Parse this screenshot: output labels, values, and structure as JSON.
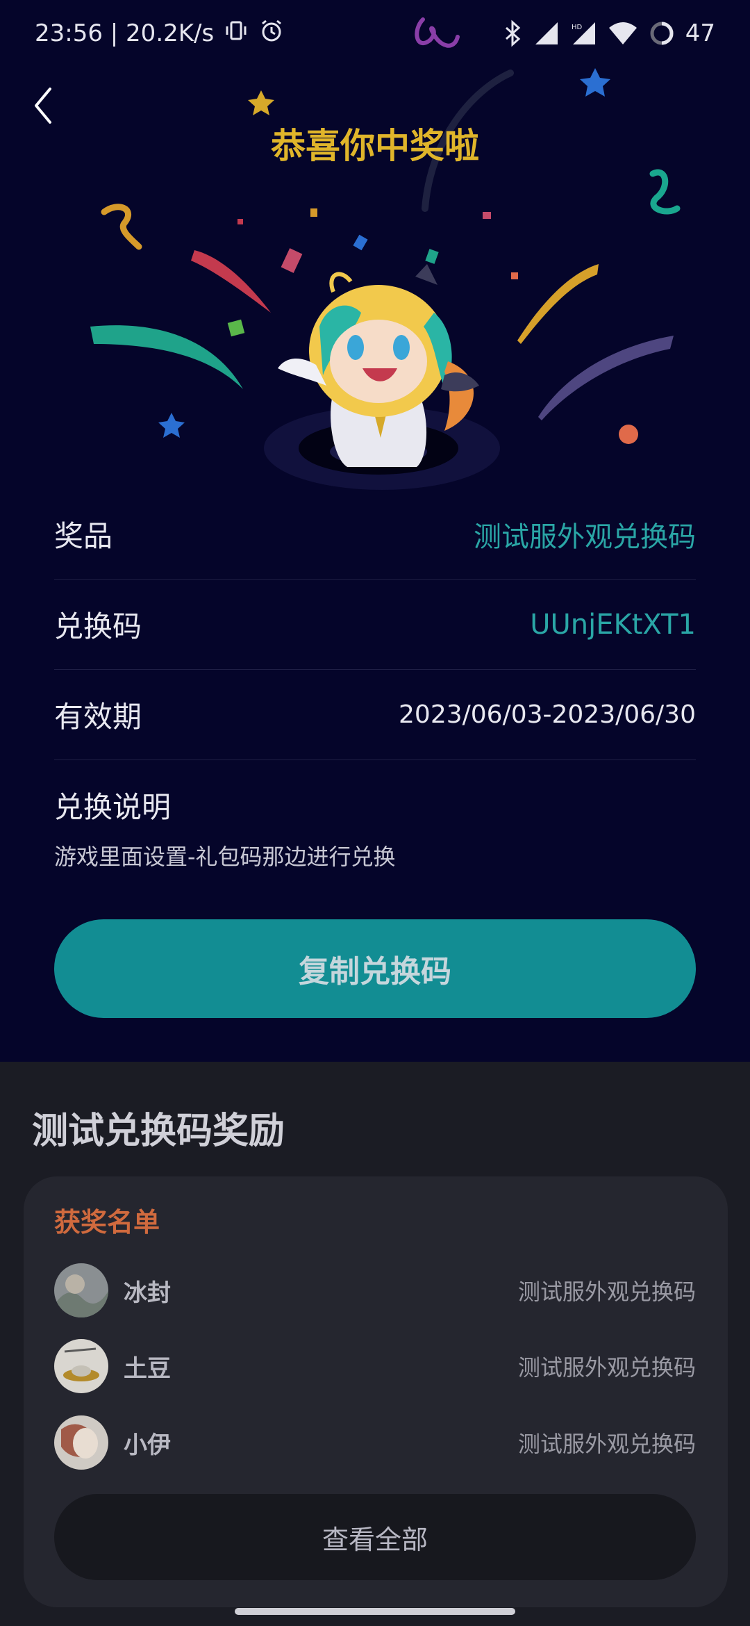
{
  "status_bar": {
    "time_speed": "23:56 | 20.2K/s",
    "battery": "47"
  },
  "hero": {
    "title": "恭喜你中奖啦"
  },
  "prize_info": {
    "prize_label": "奖品",
    "prize_value": "测试服外观兑换码",
    "code_label": "兑换码",
    "code_value": "UUnjEKtXT1",
    "validity_label": "有效期",
    "validity_value": "2023/06/03-2023/06/30",
    "instructions_label": "兑换说明",
    "instructions_text": "游戏里面设置-礼包码那边进行兑换"
  },
  "copy_button": "复制兑换码",
  "rewards_section": {
    "title": "测试兑换码奖励",
    "winners_title": "获奖名单",
    "winners": [
      {
        "name": "冰封",
        "prize": "测试服外观兑换码"
      },
      {
        "name": "土豆",
        "prize": "测试服外观兑换码"
      },
      {
        "name": "小伊",
        "prize": "测试服外观兑换码"
      }
    ],
    "view_all": "查看全部"
  },
  "colors": {
    "background": "#05052a",
    "accent_teal": "#128d93",
    "title_gold": "#e0b52a",
    "winners_orange": "#d06a3e"
  }
}
